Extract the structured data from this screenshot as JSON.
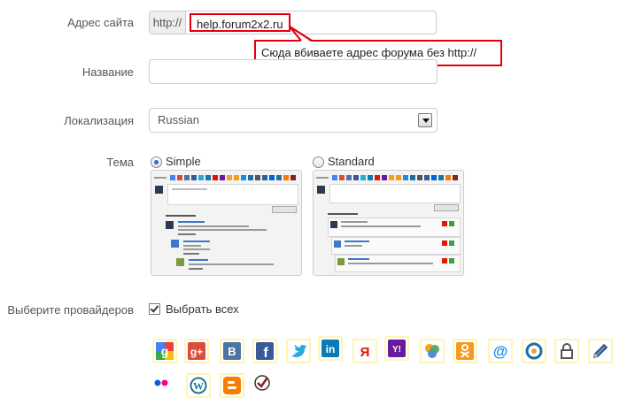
{
  "form": {
    "site_url": {
      "label": "Адрес сайта",
      "prefix": "http://",
      "value": "help.forum2x2.ru",
      "hint": "Сюда вбиваете адрес форума без http://"
    },
    "name": {
      "label": "Название",
      "value": ""
    },
    "locale": {
      "label": "Локализация",
      "selected": "Russian"
    },
    "theme": {
      "label": "Тема",
      "options": [
        {
          "label": "Simple",
          "checked": true
        },
        {
          "label": "Standard",
          "checked": false
        }
      ]
    },
    "providers": {
      "label": "Выберите провайдеров",
      "select_all_label": "Выбрать всех",
      "select_all_checked": true,
      "items": [
        {
          "icon": "google-icon",
          "color": "#4285f4"
        },
        {
          "icon": "google-plus-icon",
          "color": "#dd4b39"
        },
        {
          "icon": "vkontakte-icon",
          "color": "#4c75a3"
        },
        {
          "icon": "facebook-icon",
          "color": "#3b5998"
        },
        {
          "icon": "twitter-icon",
          "color": "#29a9e1"
        },
        {
          "icon": "linkedin-icon",
          "color": "#0a7bb5"
        },
        {
          "icon": "yandex-icon",
          "color": "#e61400"
        },
        {
          "icon": "yahoo-icon",
          "color": "#6b1a9b"
        },
        {
          "icon": "mail-agent-icon",
          "color": "#f2a41a"
        },
        {
          "icon": "odnoklassniki-icon",
          "color": "#f59a1b"
        },
        {
          "icon": "mailru-icon",
          "color": "#168de2"
        },
        {
          "icon": "livejournal-icon",
          "color": "#1e6da7"
        },
        {
          "icon": "password-lock-icon",
          "color": "#555555"
        },
        {
          "icon": "pencil-edit-icon",
          "color": "#2d5f98"
        },
        {
          "icon": "flickr-icon",
          "color": "#0063dc"
        },
        {
          "icon": "wordpress-icon",
          "color": "#21759b"
        },
        {
          "icon": "blogger-icon",
          "color": "#f57d00"
        },
        {
          "icon": "check-signin-icon",
          "color": "#8b1f24"
        }
      ]
    }
  }
}
